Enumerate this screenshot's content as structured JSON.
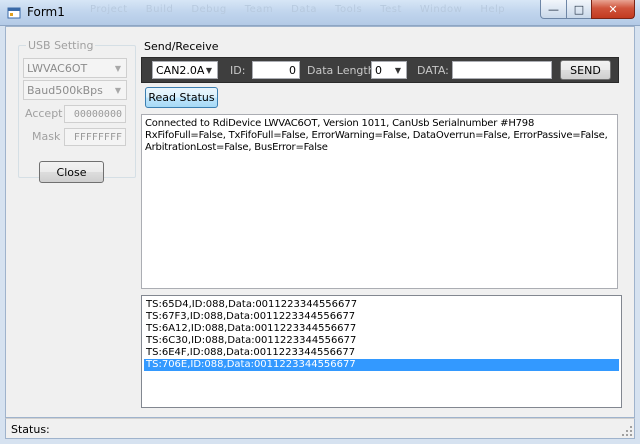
{
  "window": {
    "title": "Form1",
    "bg_menu": [
      "Project",
      "Build",
      "Debug",
      "Team",
      "Data",
      "Tools",
      "Test",
      "Window",
      "Help"
    ],
    "minimize_glyph": "—",
    "maximize_glyph": "□",
    "close_glyph": "✕"
  },
  "usb_setting": {
    "title": "USB Setting",
    "device_combo": "LWVAC6OT",
    "baud_combo": "Baud500kBps",
    "accept_label": "Accept",
    "accept_value": "00000000",
    "mask_label": "Mask",
    "mask_value": "FFFFFFFF",
    "close_button": "Close"
  },
  "send_receive": {
    "title": "Send/Receive",
    "protocol_combo": "CAN2.0A",
    "id_label": "ID:",
    "id_value": "0",
    "length_label": "Data Length:",
    "length_combo": "0",
    "data_label": "DATA:",
    "data_value": "",
    "send_button": "SEND",
    "read_status_button": "Read Status"
  },
  "info_lines": [
    "Connected to RdiDevice LWVAC6OT, Version 1011, CanUsb Serialnumber #H798",
    "RxFifoFull=False, TxFifoFull=False, ErrorWarning=False, DataOverrun=False, ErrorPassive=False,",
    "ArbitrationLost=False, BusError=False"
  ],
  "messages": [
    {
      "text": "TS:65D4,ID:088,Data:0011223344556677",
      "selected": false
    },
    {
      "text": "TS:67F3,ID:088,Data:0011223344556677",
      "selected": false
    },
    {
      "text": "TS:6A12,ID:088,Data:0011223344556677",
      "selected": false
    },
    {
      "text": "TS:6C30,ID:088,Data:0011223344556677",
      "selected": false
    },
    {
      "text": "TS:6E4F,ID:088,Data:0011223344556677",
      "selected": false
    },
    {
      "text": "TS:706E,ID:088,Data:0011223344556677",
      "selected": true
    }
  ],
  "status_bar": {
    "text": "Status:"
  },
  "colors": {
    "selection": "#3399ff",
    "toolbar_bg": "#3e3e3e",
    "close_button_red": "#c23a20"
  },
  "icons": [
    "form-app-icon",
    "chevron-down-icon",
    "size-grip-icon"
  ]
}
